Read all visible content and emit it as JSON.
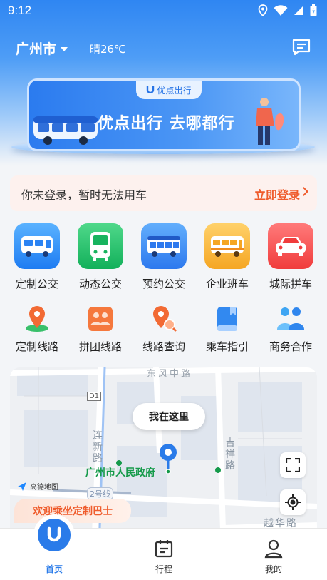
{
  "status_bar": {
    "time": "9:12"
  },
  "header": {
    "city": "广州市",
    "weather": "晴26℃"
  },
  "banner": {
    "badge": "优点出行",
    "slogan": "优点出行 去哪都行"
  },
  "login": {
    "tip": "你未登录，暂时无法用车",
    "action": "立即登录"
  },
  "services_primary": [
    {
      "label": "定制公交",
      "icon": "custom-bus-icon"
    },
    {
      "label": "动态公交",
      "icon": "dynamic-bus-icon"
    },
    {
      "label": "预约公交",
      "icon": "reserve-bus-icon"
    },
    {
      "label": "企业班车",
      "icon": "shuttle-bus-icon"
    },
    {
      "label": "城际拼车",
      "icon": "carpool-car-icon"
    }
  ],
  "services_secondary": [
    {
      "label": "定制线路",
      "icon": "route-pin-icon"
    },
    {
      "label": "拼团线路",
      "icon": "group-route-icon"
    },
    {
      "label": "线路查询",
      "icon": "route-search-icon"
    },
    {
      "label": "乘车指引",
      "icon": "guide-book-icon"
    },
    {
      "label": "商务合作",
      "icon": "partners-icon"
    }
  ],
  "map": {
    "bubble": "我在这里",
    "place": "广州市人民政府",
    "provider": "高德地图",
    "welcome": "欢迎乘坐定制巴士",
    "street_labels": [
      "东风中路",
      "连新路",
      "吉祥路",
      "2号线",
      "越华路",
      "D1"
    ]
  },
  "tabbar": [
    {
      "label": "首页",
      "active": true
    },
    {
      "label": "行程",
      "active": false
    },
    {
      "label": "我的",
      "active": false
    }
  ],
  "colors": {
    "brand": "#2a7be9",
    "login_accent": "#ef5b2b",
    "place_green": "#159a4a"
  }
}
